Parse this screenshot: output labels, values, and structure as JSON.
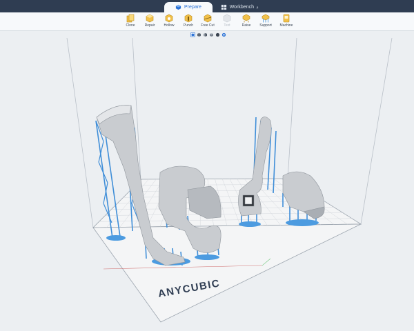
{
  "tabs": [
    {
      "label": "Prepare",
      "active": true,
      "icon": "prepare-icon"
    },
    {
      "label": "Workbench",
      "active": false,
      "icon": "grid-icon"
    }
  ],
  "tools": [
    {
      "label": "Clone",
      "icon": "clone-icon",
      "enabled": true
    },
    {
      "label": "Repair",
      "icon": "repair-icon",
      "enabled": true
    },
    {
      "label": "Hollow",
      "icon": "hollow-icon",
      "enabled": true
    },
    {
      "label": "Punch",
      "icon": "punch-icon",
      "enabled": true
    },
    {
      "label": "Free Cut",
      "icon": "free-cut-icon",
      "enabled": true
    },
    {
      "label": "Text",
      "icon": "text-icon",
      "enabled": false
    },
    {
      "label": "Raise",
      "icon": "raise-icon",
      "enabled": true
    },
    {
      "label": "Support",
      "icon": "support-icon",
      "enabled": true
    },
    {
      "label": "Machine",
      "icon": "machine-icon",
      "enabled": true
    }
  ],
  "viewbar": [
    "view-cube-icon",
    "view-front-icon",
    "view-side-icon",
    "view-iso-icon",
    "view-shade-icon",
    "view-display-icon"
  ],
  "plate": {
    "brand": "ANYCUBIC"
  },
  "colors": {
    "titlebar": "#2f3d52",
    "accent": "#2b72d6",
    "support": "#3f8ed8",
    "model": "#c9ccd0"
  }
}
